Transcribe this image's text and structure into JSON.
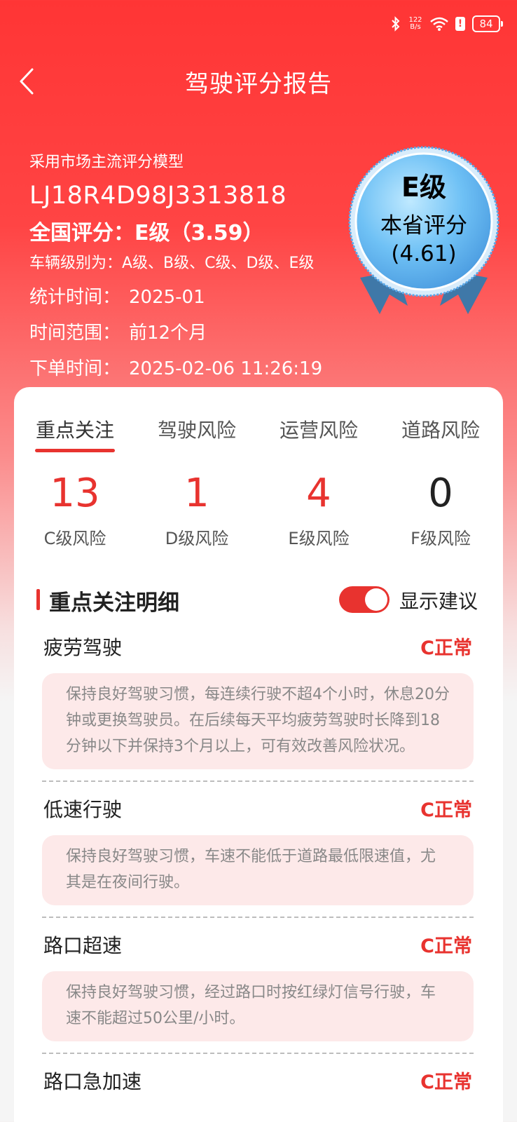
{
  "status_bar": {
    "net_speed_value": "122",
    "net_speed_unit": "B/s",
    "battery": "84",
    "icons": [
      "bluetooth-icon",
      "wifi-icon",
      "alert-icon",
      "battery-icon"
    ]
  },
  "header": {
    "title": "驾驶评分报告"
  },
  "summary": {
    "model_note": "采用市场主流评分模型",
    "vin": "LJ18R4D98J3313818",
    "national_score": "全国评分：E级（3.59）",
    "levels_note": "车辆级别为：A级、B级、C级、D级、E级",
    "stat_time_label": "统计时间：",
    "stat_time_value": "2025-01",
    "range_label": "时间范围：",
    "range_value": "前12个月",
    "order_time_label": "下单时间：",
    "order_time_value": "2025-02-06 11:26:19"
  },
  "medal": {
    "grade": "E级",
    "label": "本省评分",
    "score": "(4.61)"
  },
  "tabs": [
    {
      "label": "重点关注",
      "active": true
    },
    {
      "label": "驾驶风险",
      "active": false
    },
    {
      "label": "运营风险",
      "active": false
    },
    {
      "label": "道路风险",
      "active": false
    }
  ],
  "risk_stats": [
    {
      "value": "13",
      "label": "C级风险"
    },
    {
      "value": "1",
      "label": "D级风险"
    },
    {
      "value": "4",
      "label": "E级风险"
    },
    {
      "value": "0",
      "label": "F级风险"
    }
  ],
  "section": {
    "title": "重点关注明细",
    "toggle_label": "显示建议",
    "toggle_on": true
  },
  "items": [
    {
      "name": "疲劳驾驶",
      "status": "C正常",
      "advice": "保持良好驾驶习惯，每连续行驶不超4个小时，休息20分钟或更换驾驶员。在后续每天平均疲劳驾驶时长降到18分钟以下并保持3个月以上，可有效改善风险状况。"
    },
    {
      "name": "低速行驶",
      "status": "C正常",
      "advice": "保持良好驾驶习惯，车速不能低于道路最低限速值，尤其是在夜间行驶。"
    },
    {
      "name": "路口超速",
      "status": "C正常",
      "advice": "保持良好驾驶习惯，经过路口时按红绿灯信号行驶，车速不能超过50公里/小时。"
    },
    {
      "name": "路口急加速",
      "status": "C正常"
    }
  ],
  "colors": {
    "primary": "#e8332f",
    "header_red": "#ff3535",
    "advice_bg": "#fde9e9"
  }
}
